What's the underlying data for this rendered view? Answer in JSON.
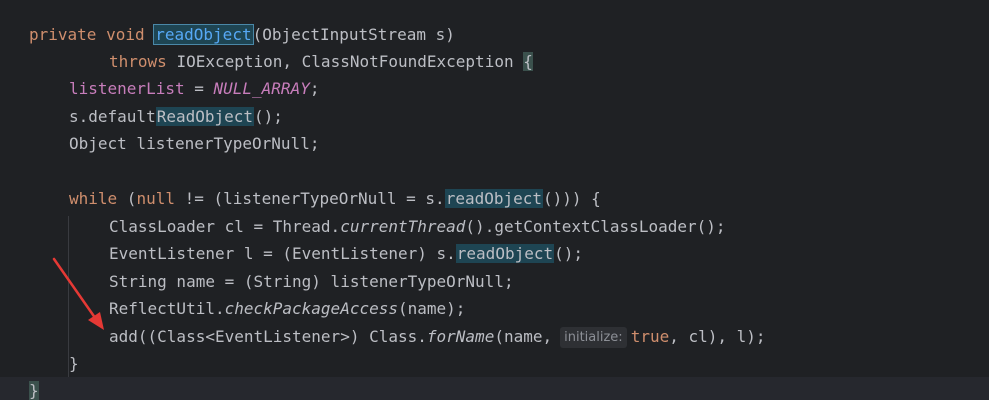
{
  "code": {
    "l1_private": "private",
    "l1_void": "void",
    "l1_method": "readObject",
    "l1_params": "(ObjectInputStream s)",
    "l2_throws": "throws",
    "l2_rest": "IOException, ClassNotFoundException ",
    "l2_brace": "{",
    "l3_field": "listenerList",
    "l3_eq": " = ",
    "l3_const": "NULL_ARRAY",
    "l3_semi": ";",
    "l4_pre": "s.default",
    "l4_call": "ReadObject",
    "l4_post": "();",
    "l5": "Object listenerTypeOrNull;",
    "l7_while": "while",
    "l7_a": " (",
    "l7_null": "null",
    "l7_b": " != (listenerTypeOrNull = s.",
    "l7_call": "readObject",
    "l7_c": "())) {",
    "l8_a": "ClassLoader cl = Thread.",
    "l8_ital": "currentThread",
    "l8_b": "().getContextClassLoader();",
    "l9_a": "EventListener l = (EventListener) s.",
    "l9_call": "readObject",
    "l9_b": "();",
    "l10": "String name = (String) listenerTypeOrNull;",
    "l11_a": "ReflectUtil.",
    "l11_ital": "checkPackageAccess",
    "l11_b": "(name);",
    "l12_a": "add((Class<EventListener>) Class.",
    "l12_ital": "forName",
    "l12_b": "(name,",
    "l12_hint": "initialize:",
    "l12_true": "true",
    "l12_c": ", cl), l);",
    "l13": "}",
    "l14": "}"
  },
  "colors": {
    "background": "#1f2124",
    "keyword": "#cf8e6d",
    "method_decl": "#56a8f5",
    "field": "#c77dbb",
    "arrow": "#e53935"
  }
}
